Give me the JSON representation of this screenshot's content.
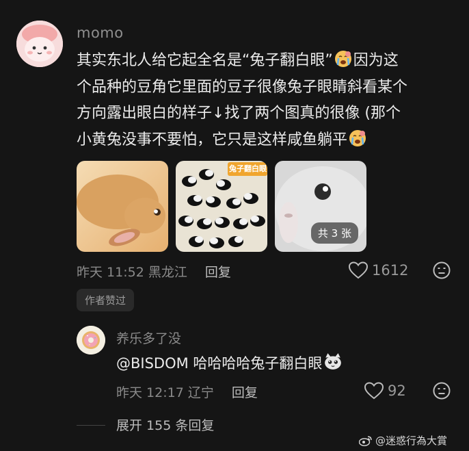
{
  "comment": {
    "username": "momo",
    "text_line1": "其实东北人给它起全名是“兔子翻白眼”",
    "text_line1b": "因为这",
    "text_line2": "个品种的豆角它里面的豆子很像兔子眼睛斜看某个",
    "text_line3": "方向露出眼白的样子↓找了两个图真的很像 (那个",
    "text_line4": "小黄兔没事不要怕，它只是这样咸鱼躺平",
    "images": [
      {
        "icon": "rabbit-lying-photo"
      },
      {
        "icon": "beans-photo",
        "overlay_text": "兔子翻白眼"
      },
      {
        "icon": "white-rabbit-photo",
        "badge": "共 3 张"
      }
    ],
    "time": "昨天 11:52",
    "location": "黑龙江",
    "reply_label": "回复",
    "likes": "1612",
    "author_badge": "作者赞过"
  },
  "reply": {
    "username": "养乐多了没",
    "text": "@BISDOM 哈哈哈哈兔子翻白眼",
    "time": "昨天 12:17",
    "location": "辽宁",
    "reply_label": "回复",
    "likes": "92"
  },
  "expand": {
    "label": "展开 155 条回复"
  },
  "watermark": "@迷惑行為大賞"
}
